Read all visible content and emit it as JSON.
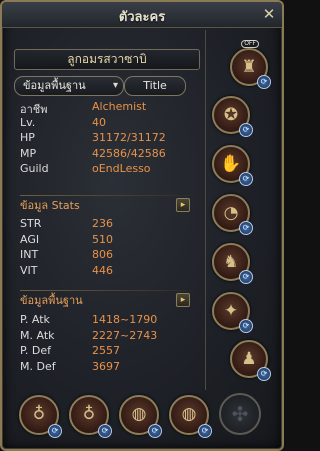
{
  "window": {
    "title": "ตัวละคร",
    "close_glyph": "✕"
  },
  "character": {
    "name": "ลูกอมรสวาซาบิ"
  },
  "controls": {
    "dropdown_label": "ข้อมูลพื้นฐาน",
    "dropdown_chevron": "▾",
    "title_button": "Title"
  },
  "basic_info": [
    {
      "label": "อาชีพ",
      "value": "Alchemist"
    },
    {
      "label": "Lv.",
      "value": "40"
    },
    {
      "label": "HP",
      "value": "31172/31172"
    },
    {
      "label": "MP",
      "value": "42586/42586"
    },
    {
      "label": "Guild",
      "value": "oEndLesso"
    }
  ],
  "stats_section": {
    "heading": "ข้อมูล Stats",
    "arrow": "▸",
    "rows": [
      {
        "label": "STR",
        "value": "236"
      },
      {
        "label": "AGI",
        "value": "510"
      },
      {
        "label": "INT",
        "value": "806"
      },
      {
        "label": "VIT",
        "value": "446"
      }
    ]
  },
  "combat_section": {
    "heading": "ข้อมูลพื้นฐาน",
    "arrow": "▸",
    "rows": [
      {
        "label": "P. Atk",
        "value": "1418~1790"
      },
      {
        "label": "M. Atk",
        "value": "2227~2743"
      },
      {
        "label": "P. Def",
        "value": "2557"
      },
      {
        "label": "M. Def",
        "value": "3697"
      }
    ]
  },
  "equipment": {
    "off_badge": "OFF",
    "swap_glyph": "⟳",
    "right_slots": [
      {
        "name": "helmet-icon",
        "glyph": "♜"
      },
      {
        "name": "amulet-icon",
        "glyph": "✪"
      },
      {
        "name": "gauntlet-icon",
        "glyph": "✋"
      },
      {
        "name": "earring-icon",
        "glyph": "◔"
      },
      {
        "name": "armor-icon",
        "glyph": "♞"
      },
      {
        "name": "belt-icon",
        "glyph": "✦"
      },
      {
        "name": "boots-icon",
        "glyph": "♟"
      }
    ],
    "bottom_slots": [
      {
        "name": "earring-left-icon",
        "glyph": "♁"
      },
      {
        "name": "earring-right-icon",
        "glyph": "♁"
      },
      {
        "name": "ring-left-icon",
        "glyph": "◍"
      },
      {
        "name": "ring-right-icon",
        "glyph": "◍"
      }
    ],
    "empty_slot_glyph": "✣"
  },
  "colors": {
    "label": "#dcdcdc",
    "value": "#e8924a",
    "heading": "#e8a05a",
    "frame": "#8a7a55"
  }
}
